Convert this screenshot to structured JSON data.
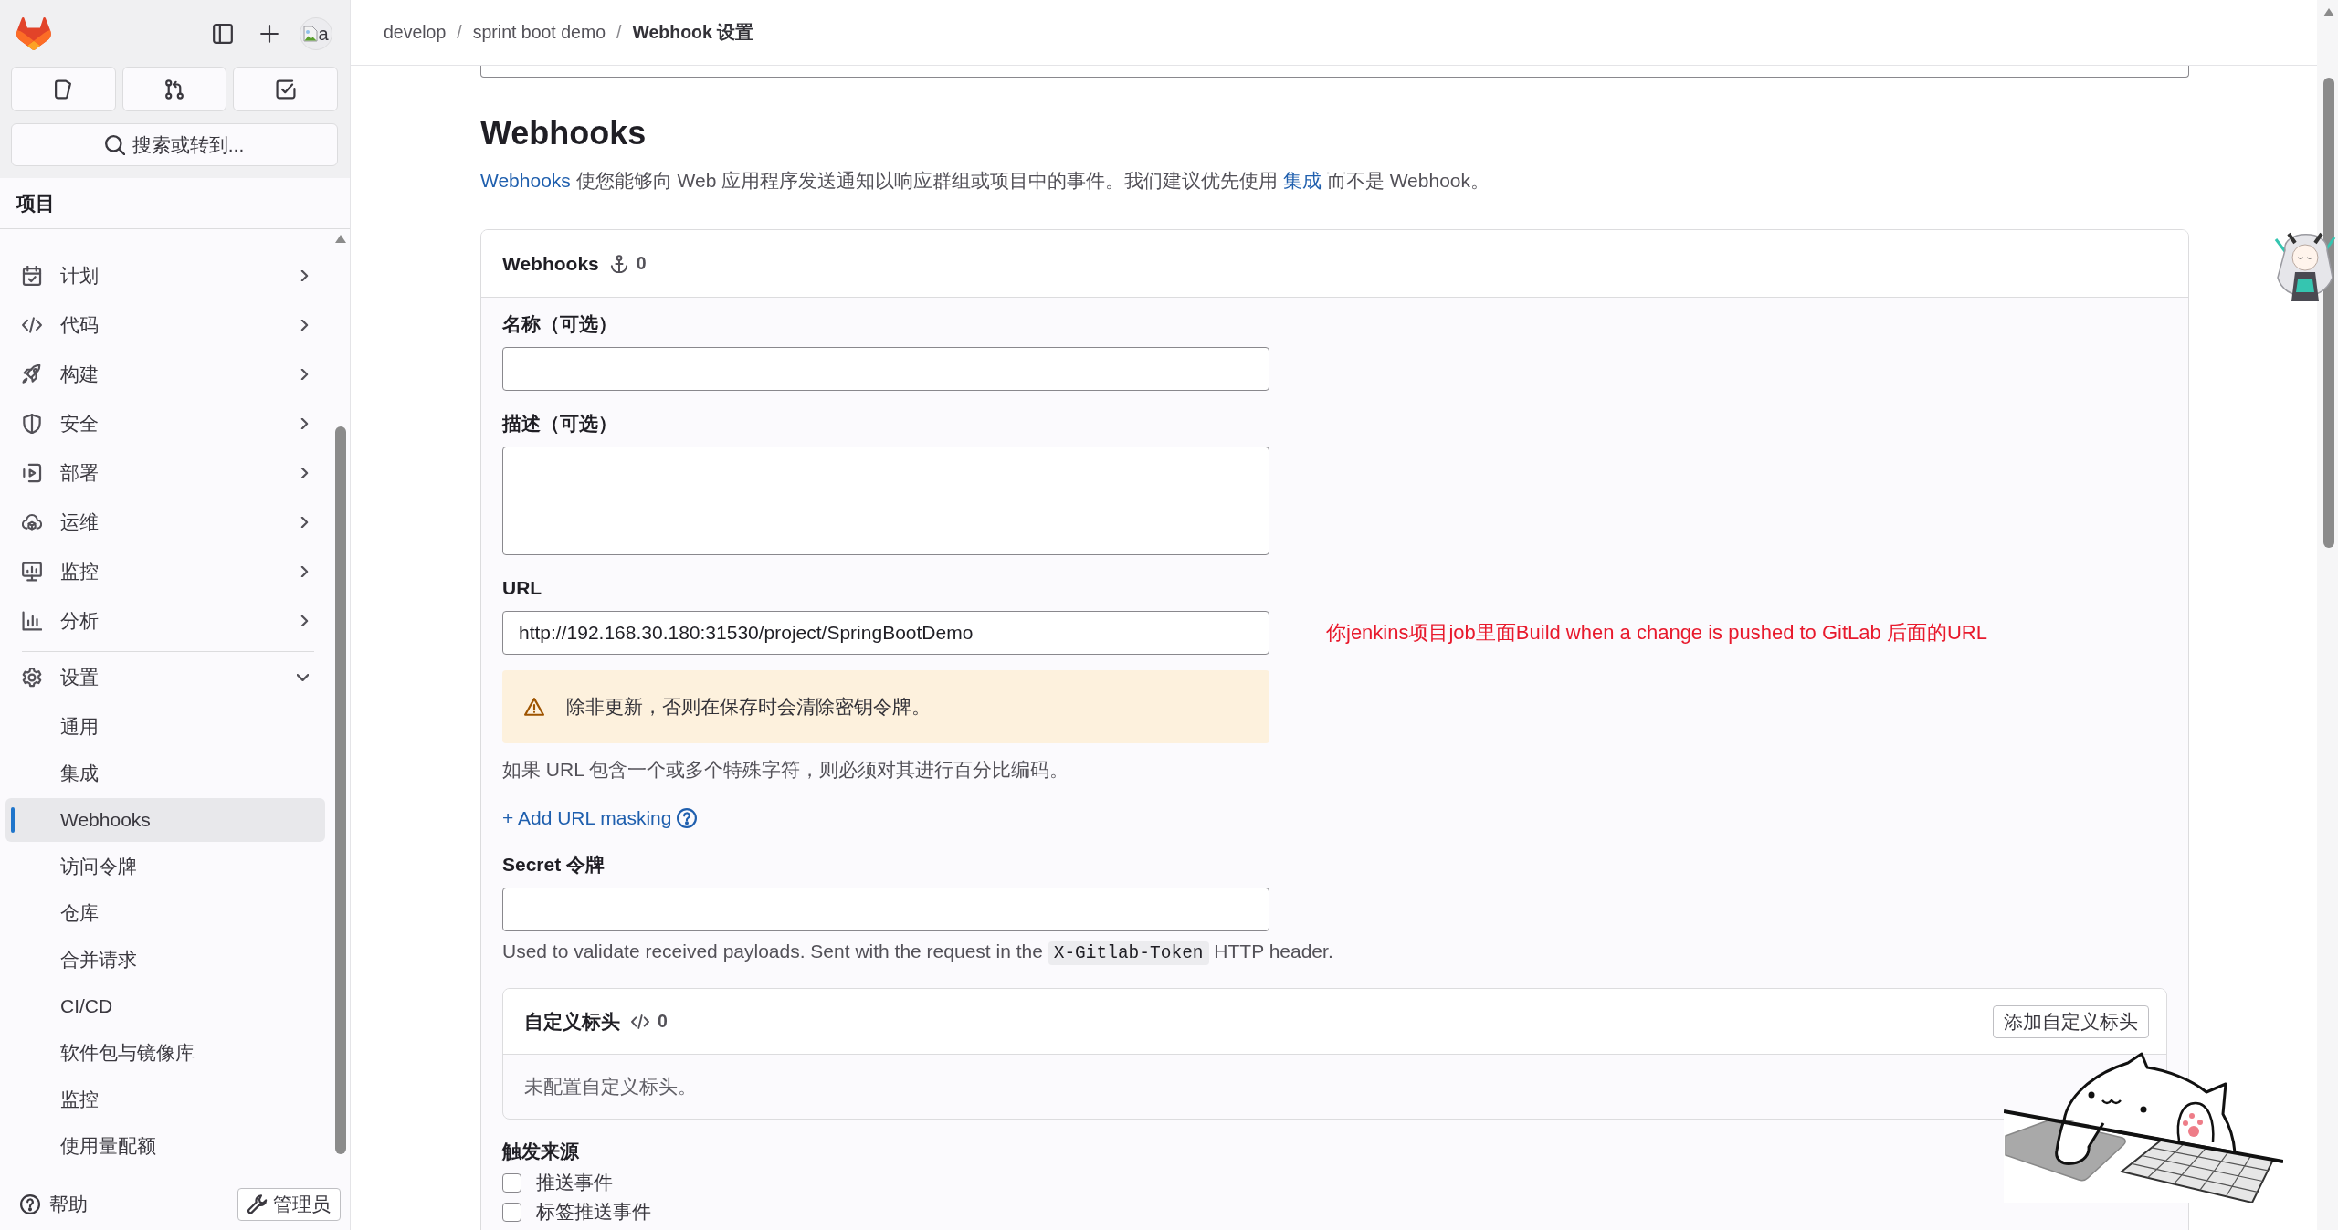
{
  "sidebar": {
    "avatar_alt": "a",
    "search": "搜索或转到...",
    "section_title": "项目",
    "sections": [
      {
        "items": [
          {
            "label": "计划",
            "expanded": false
          },
          {
            "label": "代码",
            "expanded": false
          },
          {
            "label": "构建",
            "expanded": false
          },
          {
            "label": "安全",
            "expanded": false
          },
          {
            "label": "部署",
            "expanded": false
          },
          {
            "label": "运维",
            "expanded": false
          },
          {
            "label": "监控",
            "expanded": false
          },
          {
            "label": "分析",
            "expanded": false
          }
        ]
      },
      {
        "items": [
          {
            "label": "设置",
            "expanded": true,
            "children": [
              {
                "label": "通用",
                "selected": false
              },
              {
                "label": "集成",
                "selected": false
              },
              {
                "label": "Webhooks",
                "selected": true
              },
              {
                "label": "访问令牌",
                "selected": false
              },
              {
                "label": "仓库",
                "selected": false
              },
              {
                "label": "合并请求",
                "selected": false
              },
              {
                "label": "CI/CD",
                "selected": false
              },
              {
                "label": "软件包与镜像库",
                "selected": false
              },
              {
                "label": "监控",
                "selected": false
              },
              {
                "label": "使用量配额",
                "selected": false
              }
            ]
          }
        ]
      }
    ],
    "footer": {
      "help": "帮助",
      "admin": "管理员"
    }
  },
  "breadcrumb": {
    "separator": "/",
    "items": [
      {
        "label": "develop",
        "current": false
      },
      {
        "label": "sprint boot demo",
        "current": false
      },
      {
        "label": "Webhook 设置",
        "current": true
      }
    ]
  },
  "page": {
    "title": "Webhooks",
    "intro": [
      {
        "kind": "link",
        "text": "Webhooks"
      },
      {
        "kind": "text",
        "text": " 使您能够向 Web 应用程序发送通知以响应群组或项目中的事件。我们建议优先使用 "
      },
      {
        "kind": "link",
        "text": "集成"
      },
      {
        "kind": "text",
        "text": " 而不是 Webhook。"
      }
    ]
  },
  "card": {
    "title": "Webhooks",
    "count": "0"
  },
  "form": {
    "name_field": {
      "label": "名称（可选）"
    },
    "description_field": {
      "label": "描述（可选）"
    },
    "url_field": {
      "label": "URL",
      "value": "http://192.168.30.180:31530/project/SpringBootDemo"
    },
    "url_warning": "除非更新，否则在保存时会清除密钥令牌。",
    "url_hint": "如果 URL 包含一个或多个特殊字符，则必须对其进行百分比编码。",
    "mask_link": "+ Add URL masking",
    "secret_field": {
      "label": "Secret 令牌"
    },
    "secret_hint": [
      {
        "kind": "text",
        "text": "Used to validate received payloads. Sent with the request in the "
      },
      {
        "kind": "code",
        "text": "X-Gitlab-Token"
      },
      {
        "kind": "text",
        "text": " HTTP header."
      }
    ],
    "custom_headers": {
      "title": "自定义标头",
      "count": "0",
      "add_button": "添加自定义标头",
      "empty_text": "未配置自定义标头。"
    },
    "trigger": {
      "label": "触发来源",
      "options": [
        {
          "label": "推送事件",
          "checked": false
        },
        {
          "label": "标签推送事件",
          "checked": false
        }
      ]
    }
  },
  "annotation": "你jenkins项目job里面Build when a change is pushed to GitLab 后面的URL"
}
